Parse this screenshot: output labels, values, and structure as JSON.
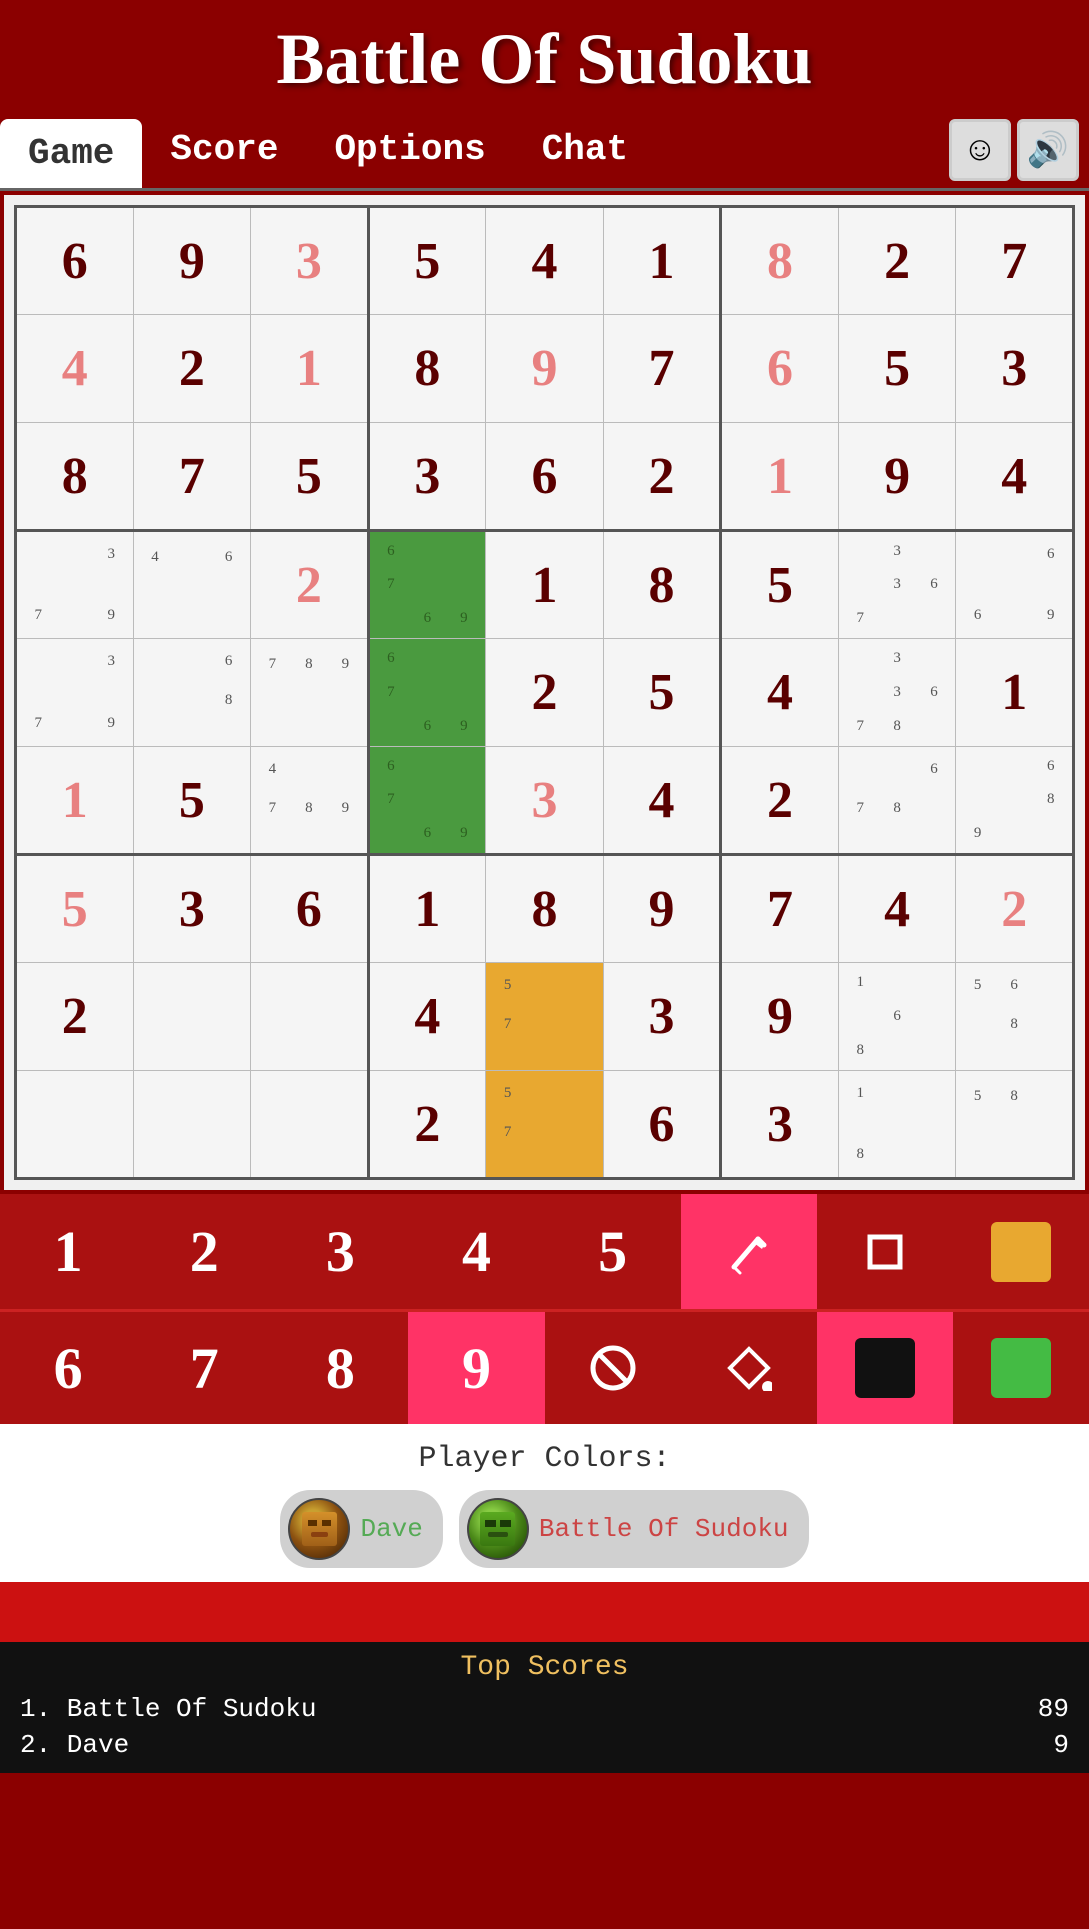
{
  "app": {
    "title": "Battle Of Sudoku"
  },
  "nav": {
    "tabs": [
      {
        "label": "Game",
        "active": true
      },
      {
        "label": "Score",
        "active": false
      },
      {
        "label": "Options",
        "active": false
      },
      {
        "label": "Chat",
        "active": false
      }
    ],
    "emoji_icon": "☺",
    "sound_icon": "🔊"
  },
  "grid": {
    "rows": [
      [
        {
          "val": "6",
          "style": "dark"
        },
        {
          "val": "9",
          "style": "dark"
        },
        {
          "val": "3",
          "style": "pink"
        },
        {
          "val": "5",
          "style": "dark"
        },
        {
          "val": "4",
          "style": "dark"
        },
        {
          "val": "1",
          "style": "dark"
        },
        {
          "val": "8",
          "style": "pink"
        },
        {
          "val": "2",
          "style": "dark"
        },
        {
          "val": "7",
          "style": "dark"
        }
      ],
      [
        {
          "val": "4",
          "style": "pink"
        },
        {
          "val": "2",
          "style": "dark"
        },
        {
          "val": "1",
          "style": "pink"
        },
        {
          "val": "8",
          "style": "dark"
        },
        {
          "val": "9",
          "style": "pink"
        },
        {
          "val": "7",
          "style": "dark"
        },
        {
          "val": "6",
          "style": "pink"
        },
        {
          "val": "5",
          "style": "dark"
        },
        {
          "val": "3",
          "style": "dark"
        }
      ],
      [
        {
          "val": "8",
          "style": "dark"
        },
        {
          "val": "7",
          "style": "dark"
        },
        {
          "val": "5",
          "style": "dark"
        },
        {
          "val": "3",
          "style": "dark"
        },
        {
          "val": "6",
          "style": "dark"
        },
        {
          "val": "2",
          "style": "dark"
        },
        {
          "val": "1",
          "style": "pink"
        },
        {
          "val": "9",
          "style": "dark"
        },
        {
          "val": "4",
          "style": "dark"
        }
      ],
      [
        {
          "val": "",
          "style": "dark",
          "notes": [
            "3",
            "",
            "",
            "7",
            "",
            "9"
          ]
        },
        {
          "val": "",
          "style": "dark",
          "notes": [
            "4",
            "6",
            "",
            "",
            "",
            ""
          ]
        },
        {
          "val": "2",
          "style": "pink"
        },
        {
          "val": "",
          "style": "green-bg",
          "notes": [
            "6",
            "",
            "7",
            "",
            "",
            "6",
            "",
            "",
            "9"
          ]
        },
        {
          "val": "1",
          "style": "dark"
        },
        {
          "val": "8",
          "style": "dark"
        },
        {
          "val": "5",
          "style": "dark"
        },
        {
          "val": "",
          "style": "dark",
          "notes": [
            "3",
            "",
            "",
            "3",
            "6",
            "",
            "7",
            "",
            ""
          ]
        },
        {
          "val": "",
          "style": "dark",
          "notes": [
            "",
            "6",
            "",
            "",
            "",
            "",
            "6",
            "",
            "9"
          ]
        }
      ],
      [
        {
          "val": "",
          "style": "dark",
          "notes": [
            "3",
            "",
            "",
            "7",
            "",
            "9"
          ]
        },
        {
          "val": "",
          "style": "dark",
          "notes": [
            "",
            "6",
            "",
            "",
            "8",
            ""
          ]
        },
        {
          "val": "",
          "style": "dark",
          "notes": [
            "7",
            "8",
            "9",
            "",
            "",
            "",
            "",
            "",
            ""
          ]
        },
        {
          "val": "",
          "style": "green-bg",
          "notes": [
            "6",
            "",
            "7",
            "",
            "",
            "6",
            "",
            "",
            "9"
          ]
        },
        {
          "val": "2",
          "style": "dark"
        },
        {
          "val": "5",
          "style": "dark"
        },
        {
          "val": "4",
          "style": "dark"
        },
        {
          "val": "",
          "style": "dark",
          "notes": [
            "3",
            "",
            "",
            "3",
            "6",
            "",
            "7",
            "8",
            ""
          ]
        },
        {
          "val": "1",
          "style": "dark"
        }
      ],
      [
        {
          "val": "1",
          "style": "pink"
        },
        {
          "val": "5",
          "style": "dark"
        },
        {
          "val": "",
          "style": "dark",
          "notes": [
            "4",
            "",
            "",
            "7",
            "8",
            "9",
            "",
            "",
            ""
          ]
        },
        {
          "val": "",
          "style": "green-bg",
          "notes": [
            "6",
            "",
            "7",
            "",
            "",
            "6",
            "",
            "",
            "9"
          ]
        },
        {
          "val": "3",
          "style": "pink"
        },
        {
          "val": "4",
          "style": "dark"
        },
        {
          "val": "2",
          "style": "dark"
        },
        {
          "val": "",
          "style": "dark",
          "notes": [
            "",
            "6",
            "",
            "7",
            "8",
            "",
            "",
            "",
            ""
          ]
        },
        {
          "val": "",
          "style": "dark",
          "notes": [
            "",
            "6",
            "",
            "",
            "8",
            "9",
            "",
            "",
            ""
          ]
        }
      ],
      [
        {
          "val": "5",
          "style": "pink"
        },
        {
          "val": "3",
          "style": "dark"
        },
        {
          "val": "6",
          "style": "dark"
        },
        {
          "val": "1",
          "style": "dark"
        },
        {
          "val": "8",
          "style": "dark"
        },
        {
          "val": "9",
          "style": "dark"
        },
        {
          "val": "7",
          "style": "dark"
        },
        {
          "val": "4",
          "style": "dark"
        },
        {
          "val": "2",
          "style": "pink"
        }
      ],
      [
        {
          "val": "2",
          "style": "dark"
        },
        {
          "val": "",
          "style": "dark"
        },
        {
          "val": "",
          "style": "dark"
        },
        {
          "val": "4",
          "style": "dark"
        },
        {
          "val": "",
          "style": "orange-bg",
          "notes": [
            "5",
            "",
            "",
            "7",
            "",
            ""
          ]
        },
        {
          "val": "3",
          "style": "dark"
        },
        {
          "val": "9",
          "style": "dark"
        },
        {
          "val": "",
          "style": "dark",
          "notes": [
            "1",
            "",
            "",
            "",
            "6",
            "",
            "8",
            "",
            ""
          ]
        },
        {
          "val": "",
          "style": "dark",
          "notes": [
            "5",
            "6",
            "",
            "",
            "8",
            "",
            "",
            "",
            ""
          ]
        }
      ],
      [
        {
          "val": "",
          "style": "dark"
        },
        {
          "val": "",
          "style": "dark"
        },
        {
          "val": "",
          "style": "dark"
        },
        {
          "val": "2",
          "style": "dark"
        },
        {
          "val": "",
          "style": "orange-bg",
          "notes": [
            "5",
            "",
            "",
            "7",
            "",
            ""
          ]
        },
        {
          "val": "6",
          "style": "dark"
        },
        {
          "val": "3",
          "style": "dark"
        },
        {
          "val": "",
          "style": "dark",
          "notes": [
            "1",
            "",
            "",
            "",
            "",
            "",
            "8",
            "",
            ""
          ]
        },
        {
          "val": "",
          "style": "dark",
          "notes": [
            "5",
            "8",
            "",
            "",
            "",
            "",
            "",
            "",
            ""
          ]
        }
      ]
    ]
  },
  "number_bar1": {
    "buttons": [
      "1",
      "2",
      "3",
      "4",
      "5"
    ],
    "tools": [
      {
        "name": "pencil",
        "symbol": "✏"
      },
      {
        "name": "square",
        "symbol": "□"
      },
      {
        "name": "color-orange",
        "color": "#e8a830"
      }
    ]
  },
  "number_bar2": {
    "buttons": [
      "6",
      "7",
      "8",
      "9"
    ],
    "highlighted": "9",
    "tools": [
      {
        "name": "no",
        "symbol": "⊘"
      },
      {
        "name": "diamond-fill",
        "symbol": "◇"
      },
      {
        "name": "color-black",
        "color": "#111111"
      },
      {
        "name": "color-green",
        "color": "#44bb44"
      }
    ]
  },
  "player_colors": {
    "title": "Player Colors:",
    "players": [
      {
        "name": "Dave",
        "name_color": "green",
        "avatar": "dave"
      },
      {
        "name": "Battle Of Sudoku",
        "name_color": "red",
        "avatar": "bot"
      }
    ]
  },
  "top_scores": {
    "title": "Top Scores",
    "entries": [
      {
        "rank": "1.",
        "name": "Battle Of Sudoku",
        "score": "89"
      },
      {
        "rank": "2.",
        "name": "Dave",
        "score": "9"
      }
    ]
  }
}
